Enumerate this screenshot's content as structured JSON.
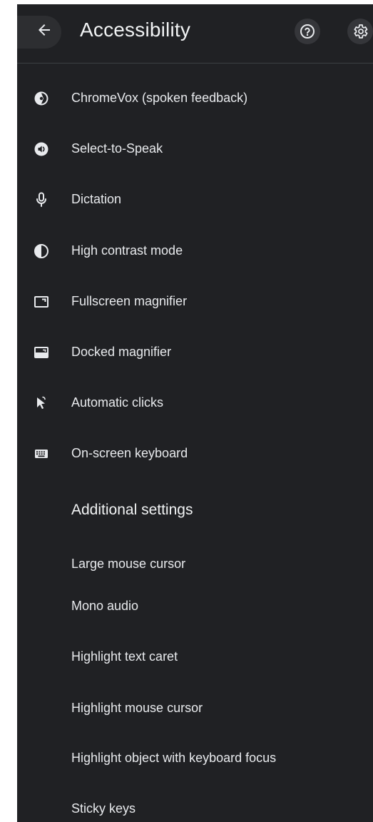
{
  "header": {
    "title": "Accessibility",
    "back_icon": "arrow-back-icon",
    "help_icon": "help-circle-icon",
    "settings_icon": "gear-icon"
  },
  "features": [
    {
      "label": "ChromeVox (spoken feedback)",
      "icon": "chromevox-icon"
    },
    {
      "label": "Select-to-Speak",
      "icon": "select-to-speak-icon"
    },
    {
      "label": "Dictation",
      "icon": "microphone-icon"
    },
    {
      "label": "High contrast mode",
      "icon": "contrast-icon"
    },
    {
      "label": "Fullscreen magnifier",
      "icon": "fullscreen-magnifier-icon"
    },
    {
      "label": "Docked magnifier",
      "icon": "docked-magnifier-icon"
    },
    {
      "label": "Automatic clicks",
      "icon": "automatic-clicks-icon"
    },
    {
      "label": "On-screen keyboard",
      "icon": "keyboard-icon"
    }
  ],
  "additional": {
    "title": "Additional settings",
    "items": [
      "Large mouse cursor",
      "Mono audio",
      "Highlight text caret",
      "Highlight mouse cursor",
      "Highlight object with keyboard focus",
      "Sticky keys"
    ]
  },
  "colors": {
    "background": "#202124",
    "text": "#e8eaed",
    "divider": "#3c4043"
  }
}
